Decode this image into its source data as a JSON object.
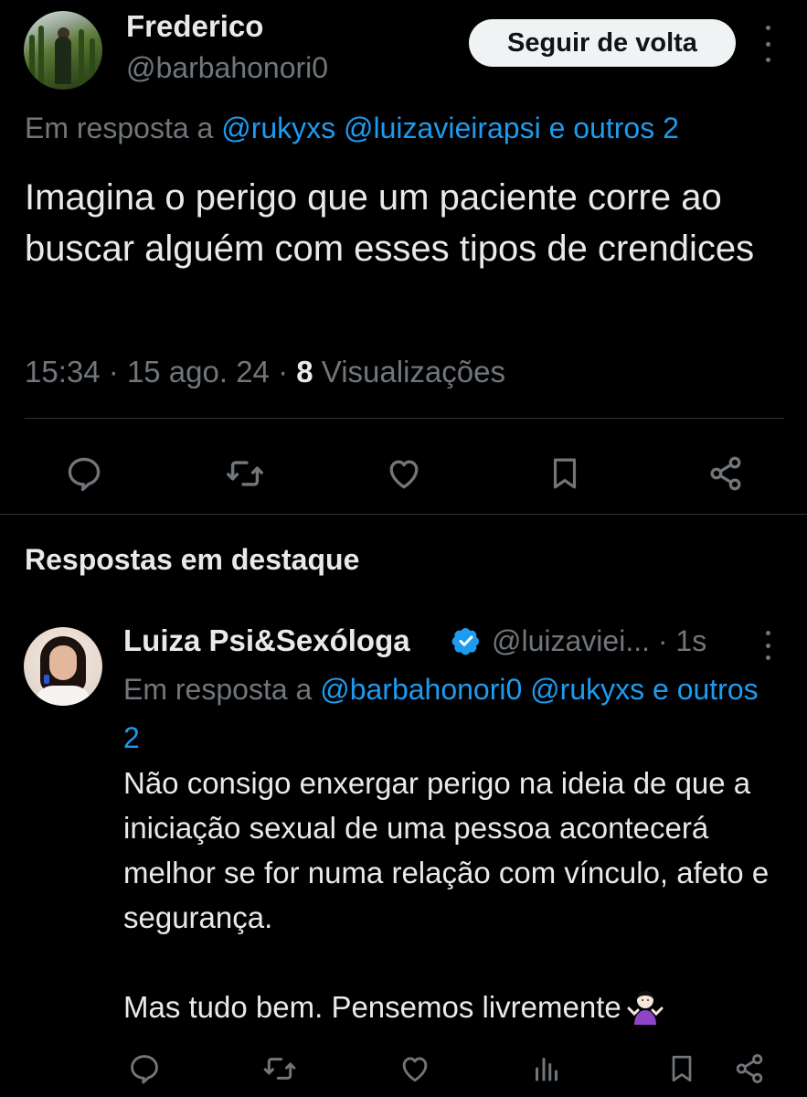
{
  "main_tweet": {
    "author_name": "Frederico",
    "author_handle": "@barbahonori0",
    "follow_button_label": "Seguir de volta",
    "reply_to_prefix": "Em resposta a",
    "reply_to_mentions": [
      "@rukyxs",
      "@luizavieirapsi",
      "e outros 2"
    ],
    "text": "Imagina o perigo que um paciente corre ao buscar alguém com esses tipos de crendices",
    "time": "15:34",
    "date": "15 ago. 24",
    "view_count": "8",
    "views_label": "Visualizações",
    "actions": [
      "reply-icon",
      "retweet-icon",
      "like-icon",
      "bookmark-icon",
      "share-icon"
    ]
  },
  "section": {
    "title": "Respostas em destaque"
  },
  "reply_tweet": {
    "author_name": "Luiza Psi&Sexóloga",
    "verified": true,
    "author_handle": "@luizaviei...",
    "time_ago": "1s",
    "reply_to_prefix": "Em resposta a",
    "reply_to_mentions": [
      "@barbahonori0",
      "@rukyxs",
      "e outros 2"
    ],
    "text": "Não consigo enxergar perigo na ideia de que a iniciação sexual de uma pessoa acontecerá melhor se for numa relação com vínculo, afeto e segurança.\n\nMas tudo bem. Pensemos livremente",
    "emoji": "person-shrugging",
    "actions": [
      "reply-icon",
      "retweet-icon",
      "like-icon",
      "views-icon",
      "bookmark-icon",
      "share-icon"
    ]
  },
  "colors": {
    "background": "#000000",
    "text_primary": "#e7e9ea",
    "text_secondary": "#71767b",
    "link": "#1d9bf0",
    "divider": "#2f3336",
    "follow_button_bg": "#eff3f4",
    "verified_badge": "#1d9bf0"
  }
}
